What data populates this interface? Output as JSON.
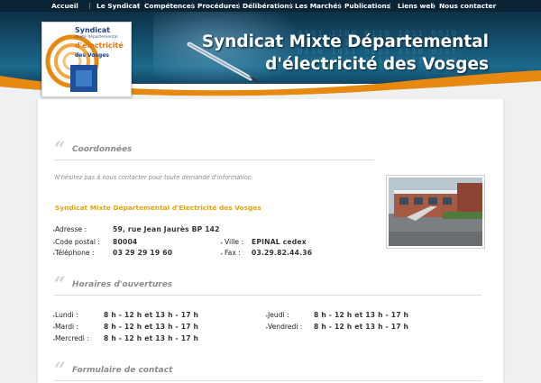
{
  "nav": {
    "items": [
      "Accueil",
      "Le Syndicat",
      "Compétences",
      "Procédures",
      "Délibérations",
      "Les Marchés",
      "Publications",
      "Liens web",
      "Nous contacter"
    ]
  },
  "header": {
    "title_line1": "Syndicat Mixte Départemental",
    "title_line2": "d'électricité des Vosges"
  },
  "logo": {
    "line1": "Syndicat",
    "line2": "mixte départemental",
    "line3": "d'électricité",
    "line4": "des Vosges"
  },
  "contact": {
    "section_title": "Coordonnées",
    "intro": "N'hésitez pas à nous contacter pour toute demande d'information.",
    "org_name": "Syndicat Mixte Départemental d'Electricité des Vosges",
    "address_label": "Adresse :",
    "address_value": "59, rue Jean Jaurès BP 142",
    "postal_label": "Code postal :",
    "postal_value": "80004",
    "city_label": "Ville :",
    "city_value": "EPINAL cedex",
    "phone_label": "Téléphone :",
    "phone_value": "03 29 29 19 60",
    "fax_label": "Fax :",
    "fax_value": "03.29.82.44.36"
  },
  "hours": {
    "section_title": "Horaires d'ouvertures",
    "left": [
      {
        "day": "Lundi :",
        "hours": "8 h - 12 h et 13 h - 17 h"
      },
      {
        "day": "Mardi :",
        "hours": "8 h - 12 h et 13 h - 17 h"
      },
      {
        "day": "Mercredi :",
        "hours": "8 h - 12 h et 13 h - 17 h"
      }
    ],
    "right": [
      {
        "day": "Jeudi :",
        "hours": "8 h - 12 h et 13 h - 17 h"
      },
      {
        "day": "Vendredi :",
        "hours": "8 h - 12 h et 13 h - 17 h"
      }
    ]
  },
  "form": {
    "section_title": "Formulaire de contact"
  },
  "colors": {
    "nav_bg": "#0b2435",
    "banner": "#165574",
    "accent_orange": "#e8890f",
    "org_name": "#e3a40e"
  },
  "icons": {
    "quote": "opening-quote-icon",
    "bullet": "bullet-dot-icon"
  }
}
